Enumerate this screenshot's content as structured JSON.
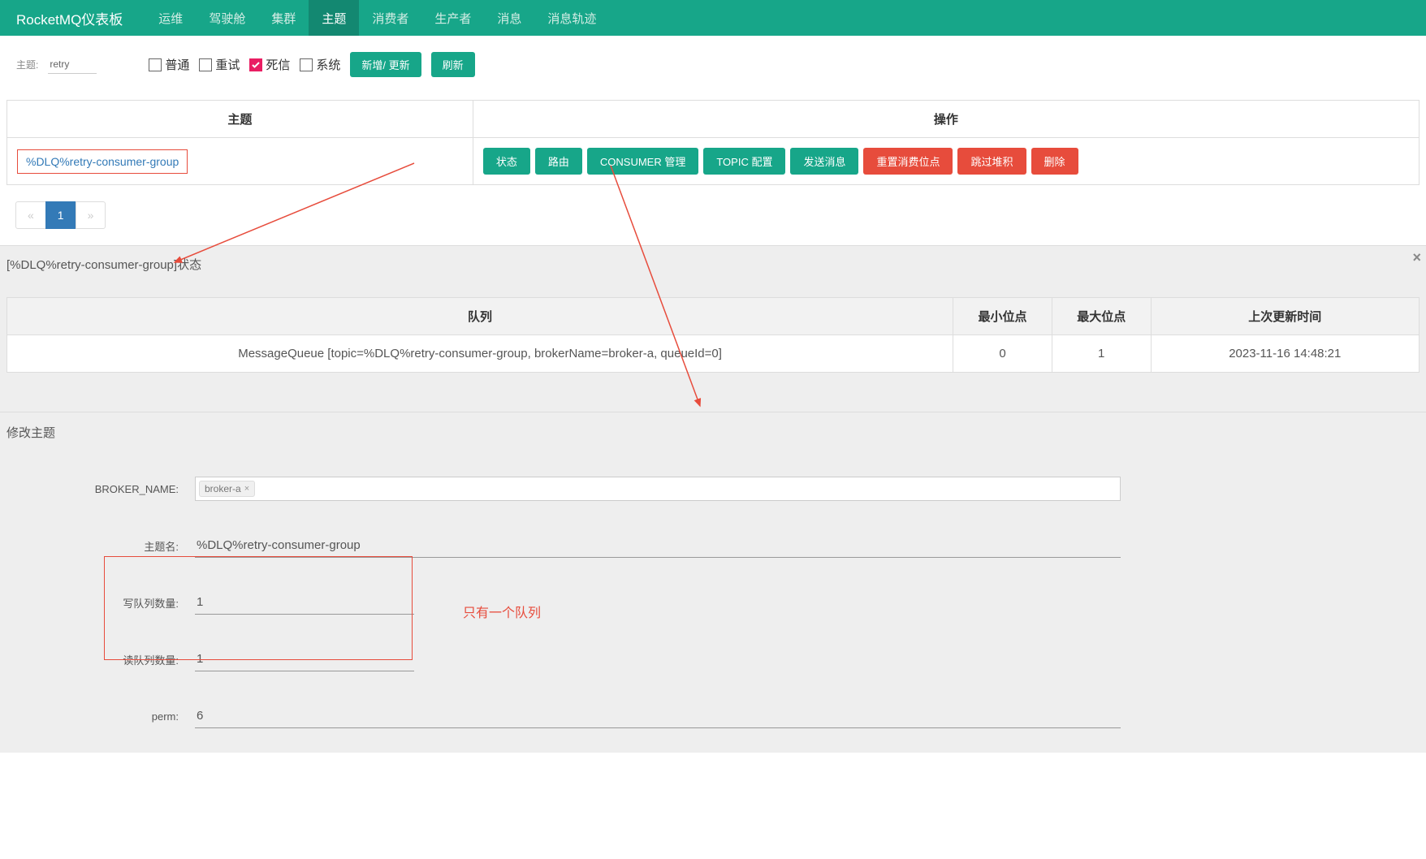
{
  "navbar": {
    "brand": "RocketMQ仪表板",
    "items": [
      "运维",
      "驾驶舱",
      "集群",
      "主题",
      "消费者",
      "生产者",
      "消息",
      "消息轨迹"
    ],
    "active_index": 3
  },
  "filter": {
    "label": "主题:",
    "value": "retry",
    "checkboxes": [
      {
        "label": "普通",
        "checked": false
      },
      {
        "label": "重试",
        "checked": false
      },
      {
        "label": "死信",
        "checked": true
      },
      {
        "label": "系统",
        "checked": false
      }
    ],
    "btn_add": "新增/ 更新",
    "btn_refresh": "刷新"
  },
  "table": {
    "col_topic": "主题",
    "col_ops": "操作",
    "rows": [
      {
        "topic": "%DLQ%retry-consumer-group",
        "buttons_teal": [
          "状态",
          "路由",
          "CONSUMER 管理",
          "TOPIC 配置",
          "发送消息"
        ],
        "buttons_red": [
          "重置消费位点",
          "跳过堆积",
          "删除"
        ]
      }
    ]
  },
  "pagination": {
    "prev": "«",
    "next": "»",
    "pages": [
      "1"
    ],
    "active": 0
  },
  "status": {
    "title": "[%DLQ%retry-consumer-group]状态",
    "headers": [
      "队列",
      "最小位点",
      "最大位点",
      "上次更新时间"
    ],
    "rows": [
      {
        "queue": "MessageQueue [topic=%DLQ%retry-consumer-group, brokerName=broker-a, queueId=0]",
        "min": "0",
        "max": "1",
        "time": "2023-11-16 14:48:21"
      }
    ]
  },
  "modify": {
    "title": "修改主题",
    "fields": {
      "broker_name_label": "BROKER_NAME:",
      "broker_name_chip": "broker-a",
      "topic_name_label": "主题名:",
      "topic_name_value": "%DLQ%retry-consumer-group",
      "write_q_label": "写队列数量:",
      "write_q_value": "1",
      "read_q_label": "读队列数量:",
      "read_q_value": "1",
      "perm_label": "perm:",
      "perm_value": "6"
    }
  },
  "annotation": {
    "only_one_queue": "只有一个队列"
  }
}
